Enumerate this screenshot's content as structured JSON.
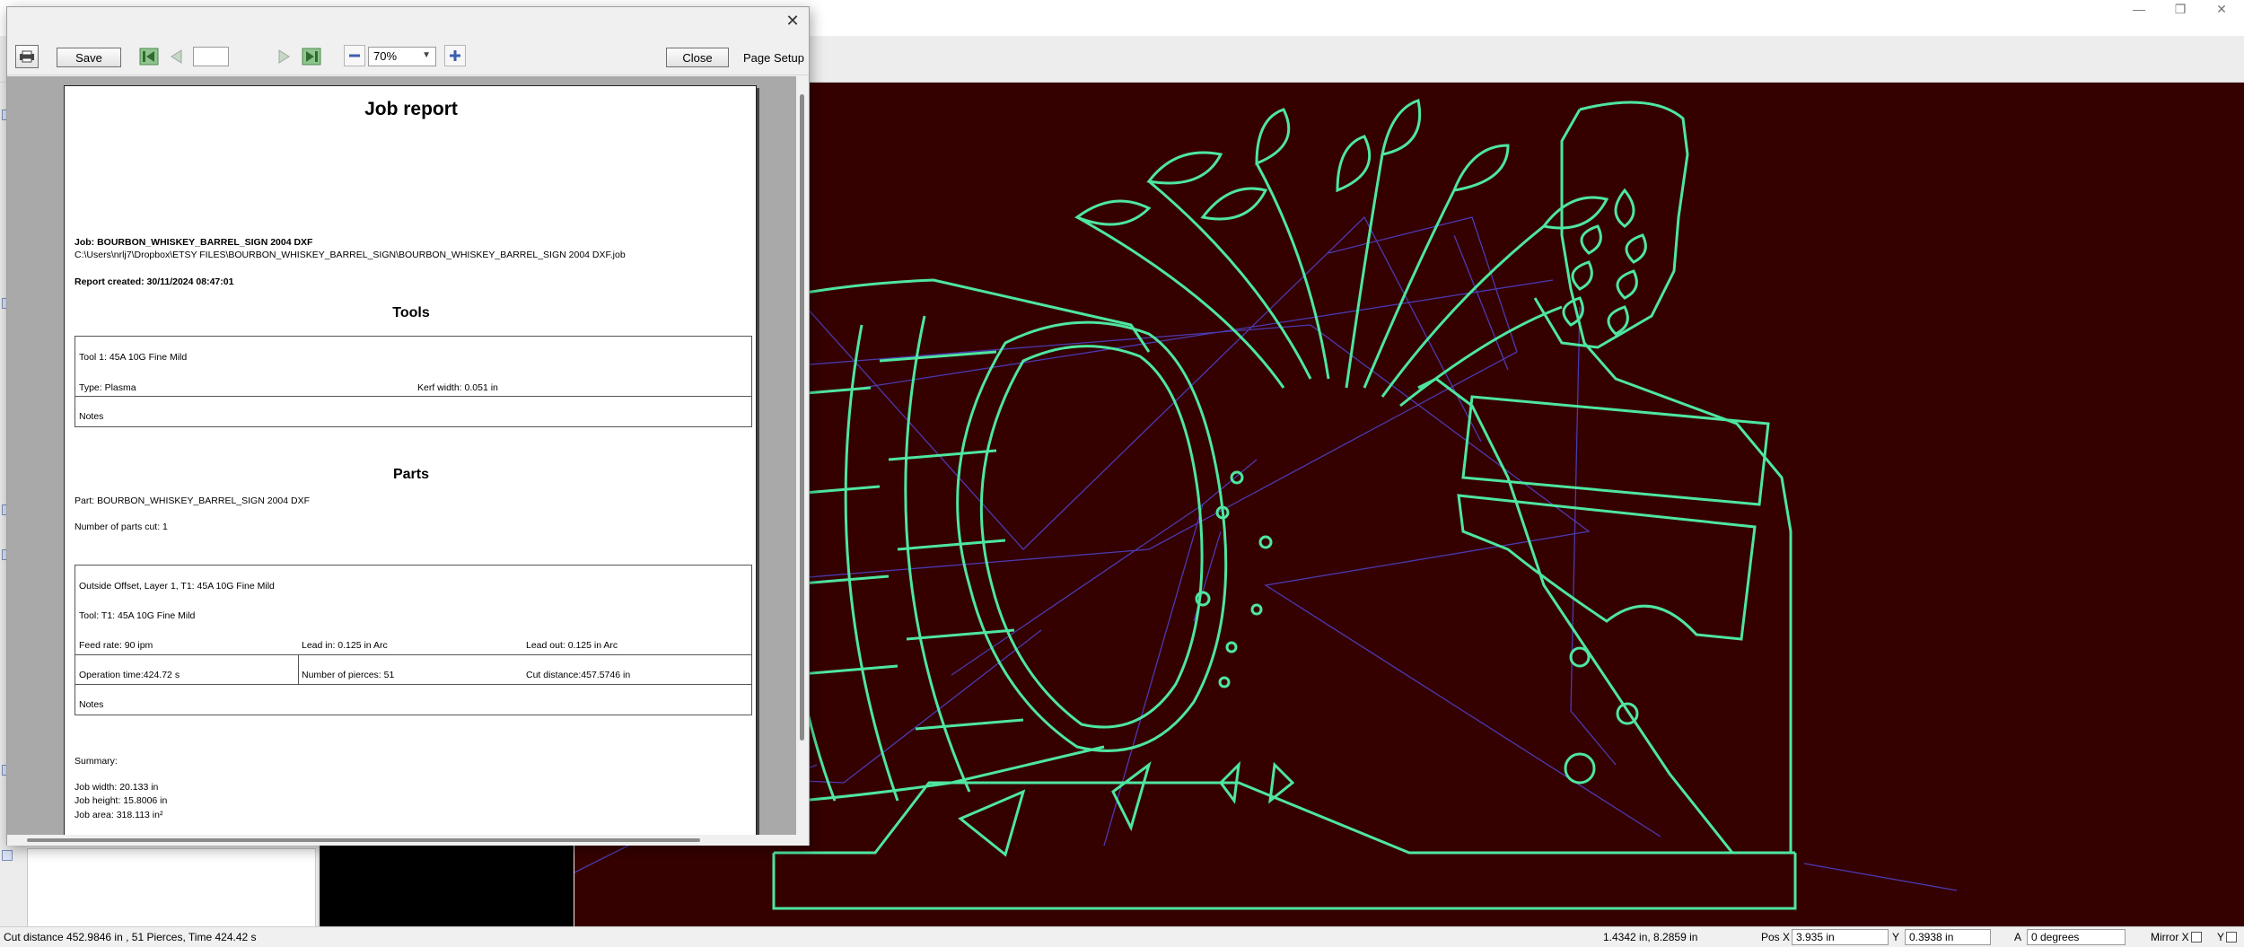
{
  "statusbar": {
    "summary": "Cut distance 452.9846 in , 51 Pierces, Time 424.42 s",
    "cursor_coords": "1.4342 in, 8.2859 in",
    "pos_x_label": "Pos X",
    "pos_x_value": "3.935 in",
    "pos_y_label": "Y",
    "pos_y_value": "0.3938 in",
    "angle_label": "A",
    "angle_value": "0 degrees",
    "mirror_x_label": "Mirror X",
    "mirror_y_label": "Y"
  },
  "dialog": {
    "toolbar": {
      "save_label": "Save",
      "close_label": "Close",
      "page_setup_label": "Page Setup",
      "zoom_value": "70%",
      "page_value": ""
    },
    "report": {
      "title": "Job report",
      "job_line": "Job: BOURBON_WHISKEY_BARREL_SIGN 2004 DXF",
      "path_line": "C:\\Users\\nrlj7\\Dropbox\\ETSY FILES\\BOURBON_WHISKEY_BARREL_SIGN\\BOURBON_WHISKEY_BARREL_SIGN 2004 DXF.job",
      "created_line": "Report created: 30/11/2024 08:47:01",
      "tools_heading": "Tools",
      "tool": {
        "name": "Tool 1: 45A 10G Fine Mild",
        "type": "Type: Plasma",
        "kerf": "Kerf width: 0.051 in",
        "notes": "Notes"
      },
      "parts_heading": "Parts",
      "part_line": "Part: BOURBON_WHISKEY_BARREL_SIGN 2004 DXF",
      "parts_cut_line": "Number of parts cut: 1",
      "operation": {
        "name": "Outside Offset, Layer 1, T1: 45A 10G Fine Mild",
        "tool": "Tool: T1: 45A 10G Fine Mild",
        "feed_rate": "Feed rate: 90 ipm",
        "lead_in": "Lead in: 0.125 in Arc",
        "lead_out": "Lead out: 0.125 in Arc",
        "op_time": "Operation time:424.72 s",
        "pierces": "Number of pierces: 51",
        "cut_distance": "Cut distance:457.5746 in",
        "notes": "Notes"
      },
      "summary": {
        "heading": "Summary:",
        "width": "Job width: 20.133 in",
        "height": "Job height: 15.8006 in",
        "area": "Job area: 318.113 in²"
      }
    }
  },
  "icons": {
    "print": "print-icon",
    "first": "first-page-icon",
    "prev": "previous-page-icon",
    "next": "next-page-icon",
    "last": "last-page-icon",
    "zoom_out": "zoom-out-icon",
    "zoom_in": "zoom-in-icon",
    "close": "close-icon"
  },
  "colors": {
    "canvas_bg": "#350000",
    "cut_path": "#4ee6a0",
    "rapid_path": "#4a3ab0"
  }
}
